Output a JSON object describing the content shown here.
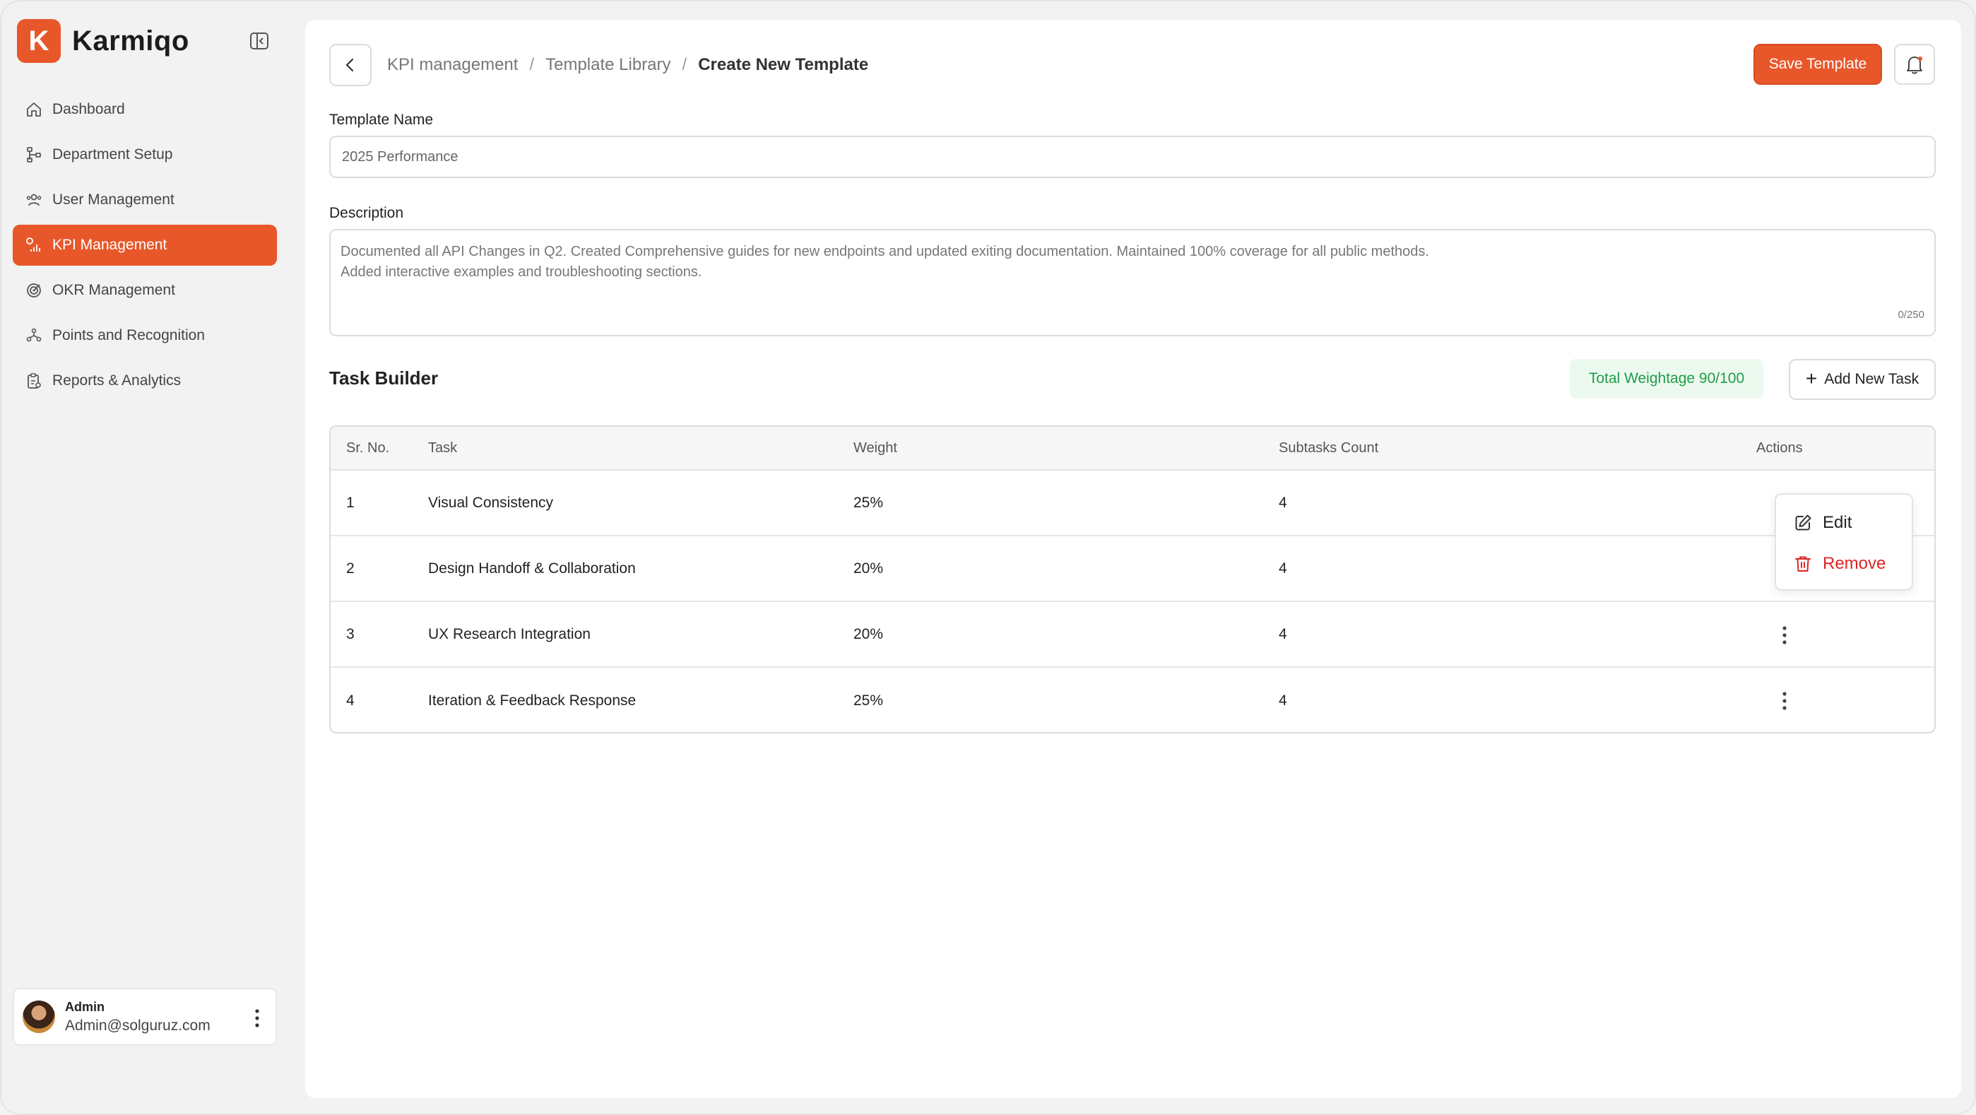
{
  "brand": {
    "logo_letter": "K",
    "name": "Karmiqo"
  },
  "sidebar": {
    "items": [
      {
        "label": "Dashboard",
        "icon": "home-icon",
        "active": false
      },
      {
        "label": "Department Setup",
        "icon": "hierarchy-icon",
        "active": false
      },
      {
        "label": "User Management",
        "icon": "users-icon",
        "active": false
      },
      {
        "label": "KPI Management",
        "icon": "kpi-chart-icon",
        "active": true
      },
      {
        "label": "OKR Management",
        "icon": "target-icon",
        "active": false
      },
      {
        "label": "Points and Recognition",
        "icon": "recognition-icon",
        "active": false
      },
      {
        "label": "Reports & Analytics",
        "icon": "report-icon",
        "active": false
      }
    ],
    "user": {
      "role": "Admin",
      "email": "Admin@solguruz.com"
    }
  },
  "header": {
    "breadcrumb": [
      "KPI management",
      "Template Library",
      "Create New Template"
    ],
    "separator": "/",
    "save_label": "Save Template"
  },
  "form": {
    "template_name_label": "Template Name",
    "template_name_value": "2025 Performance",
    "description_label": "Description",
    "description_line1": "Documented all API Changes in Q2. Created Comprehensive guides for new endpoints and updated exiting documentation. Maintained 100% coverage for all public methods.",
    "description_line2": "Added interactive examples and troubleshooting sections.",
    "description_counter": "0/250"
  },
  "task_builder": {
    "title": "Task Builder",
    "total_weightage": "Total Weightage 90/100",
    "add_label": "Add New Task",
    "columns": [
      "Sr. No.",
      "Task",
      "Weight",
      "Subtasks Count",
      "Actions"
    ],
    "rows": [
      {
        "sr": "1",
        "task": "Visual Consistency",
        "weight": "25%",
        "subtasks": "4"
      },
      {
        "sr": "2",
        "task": "Design Handoff & Collaboration",
        "weight": "20%",
        "subtasks": "4"
      },
      {
        "sr": "3",
        "task": "UX Research Integration",
        "weight": "20%",
        "subtasks": "4"
      },
      {
        "sr": "4",
        "task": "Iteration & Feedback Response",
        "weight": "25%",
        "subtasks": "4"
      }
    ]
  },
  "actions_menu": {
    "edit": "Edit",
    "remove": "Remove"
  },
  "colors": {
    "accent": "#e8572a",
    "success": "#1f9d4a",
    "danger": "#e02424"
  }
}
